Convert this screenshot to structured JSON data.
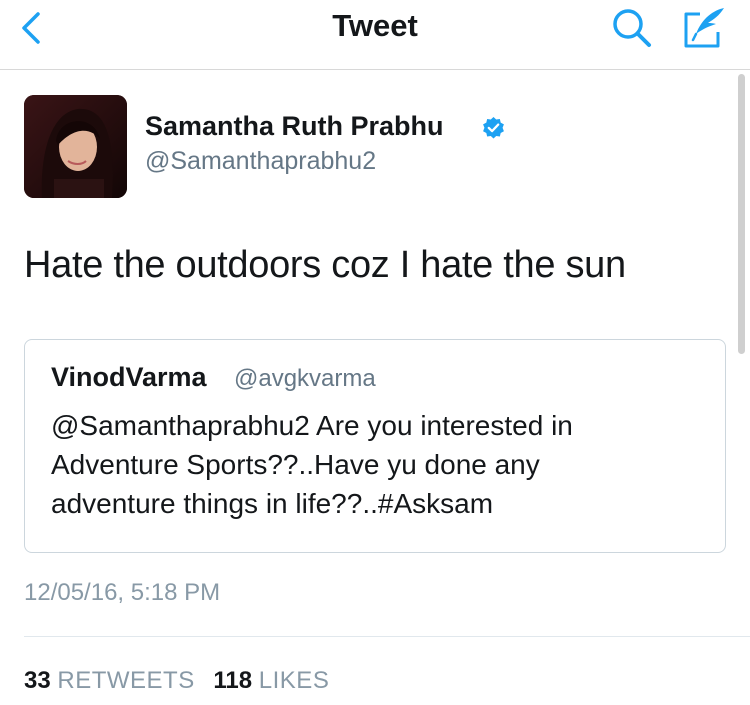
{
  "colors": {
    "accent": "#1da1f2",
    "text": "#14171a",
    "secondary_text": "#657786",
    "verified_badge": "#1da1f2"
  },
  "navbar": {
    "title": "Tweet",
    "back_icon": "chevron-left-icon",
    "search_icon": "search-icon",
    "compose_icon": "compose-quill-icon"
  },
  "tweet": {
    "author": {
      "display_name": "Samantha Ruth Prabhu",
      "handle": "@Samanthaprabhu2",
      "verified": true
    },
    "text": "Hate the outdoors coz I hate the sun",
    "quoted": {
      "display_name": "VinodVarma",
      "handle": "@avgkvarma",
      "lines": [
        "@Samanthaprabhu2 Are you interested in",
        "Adventure Sports??..Have yu done any",
        "adventure things in life??..#Asksam"
      ]
    },
    "timestamp": "12/05/16, 5:18 PM",
    "stats": {
      "retweets_count": "33",
      "retweets_label": "RETWEETS",
      "likes_count": "118",
      "likes_label": "LIKES"
    }
  }
}
